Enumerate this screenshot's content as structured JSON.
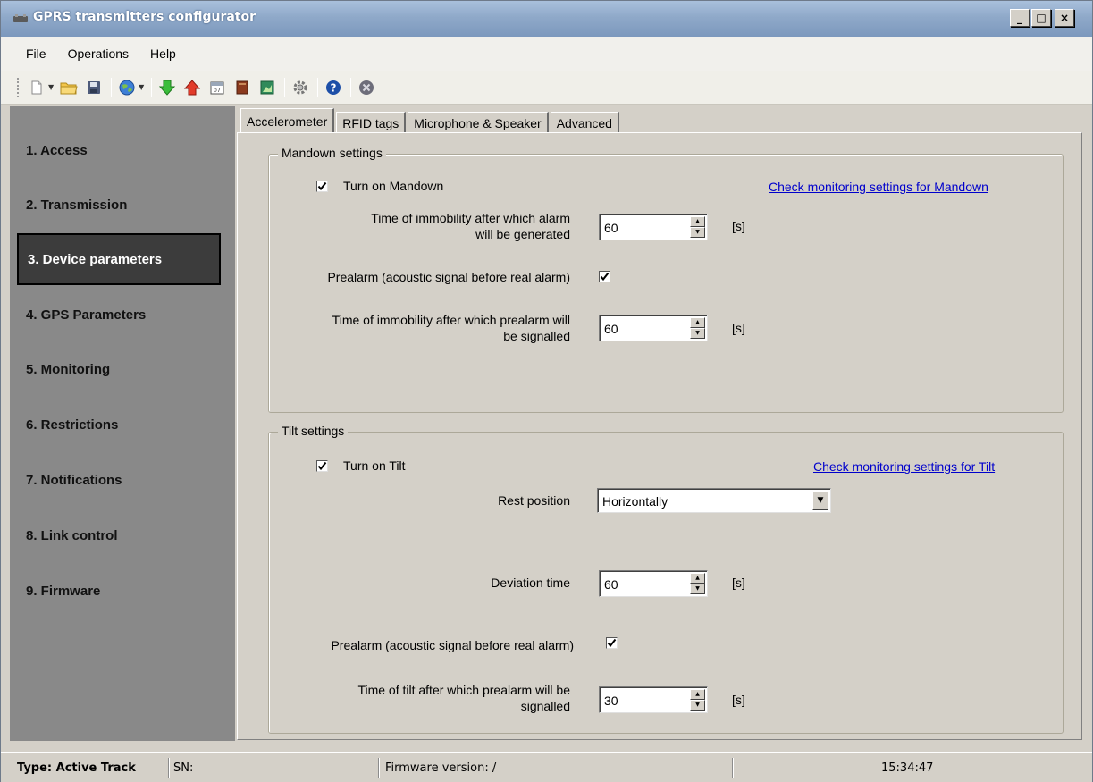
{
  "window": {
    "title": "GPRS transmitters configurator",
    "buttons": {
      "minimize": "_",
      "maximize": "□",
      "close": "×"
    }
  },
  "menu": {
    "items": [
      "File",
      "Operations",
      "Help"
    ]
  },
  "toolbar": {
    "icons": [
      "new-icon",
      "open-folder-icon",
      "save-disk-icon",
      "globe-icon",
      "download-arrow-icon",
      "upload-arrow-icon",
      "calendar-icon",
      "book-icon",
      "image-icon",
      "settings-gear-icon",
      "help-icon",
      "exit-icon"
    ]
  },
  "sidebar": {
    "items": [
      {
        "label": "1. Access"
      },
      {
        "label": "2. Transmission"
      },
      {
        "label": "3. Device parameters",
        "active": true
      },
      {
        "label": "4. GPS Parameters"
      },
      {
        "label": "5. Monitoring"
      },
      {
        "label": "6. Restrictions"
      },
      {
        "label": "7. Notifications"
      },
      {
        "label": "8. Link control"
      },
      {
        "label": "9. Firmware"
      }
    ]
  },
  "tabs": [
    "Accelerometer",
    "RFID tags",
    "Microphone & Speaker",
    "Advanced"
  ],
  "mandown": {
    "legend": "Mandown settings",
    "turn_on_label": "Turn on Mandown",
    "turn_on_checked": true,
    "monitoring_link": "Check monitoring settings for Mandown",
    "immobility_label_1": "Time of immobility after which alarm",
    "immobility_label_2": "will be generated",
    "immobility_value": "60",
    "immobility_unit": "[s]",
    "prealarm_label": "Prealarm (acoustic signal before real alarm)",
    "prealarm_checked": true,
    "pre_immobility_label_1": "Time of immobility after which prealarm will",
    "pre_immobility_label_2": "be signalled",
    "pre_immobility_value": "60",
    "pre_immobility_unit": "[s]"
  },
  "tilt": {
    "legend": "Tilt settings",
    "turn_on_label": "Turn on Tilt",
    "turn_on_checked": true,
    "monitoring_link": "Check monitoring settings for Tilt",
    "rest_position_label": "Rest position",
    "rest_position_value": "Horizontally",
    "deviation_label": "Deviation time",
    "deviation_value": "60",
    "deviation_unit": "[s]",
    "prealarm_label": "Prealarm (acoustic signal before real alarm)",
    "prealarm_checked": true,
    "tilt_time_label_1": "Time of tilt after which prealarm will be",
    "tilt_time_label_2": "signalled",
    "tilt_time_value": "30",
    "tilt_time_unit": "[s]"
  },
  "status": {
    "type": "Type: Active Track",
    "sn": "SN:",
    "firmware": "Firmware version: /",
    "time": "15:34:47"
  }
}
